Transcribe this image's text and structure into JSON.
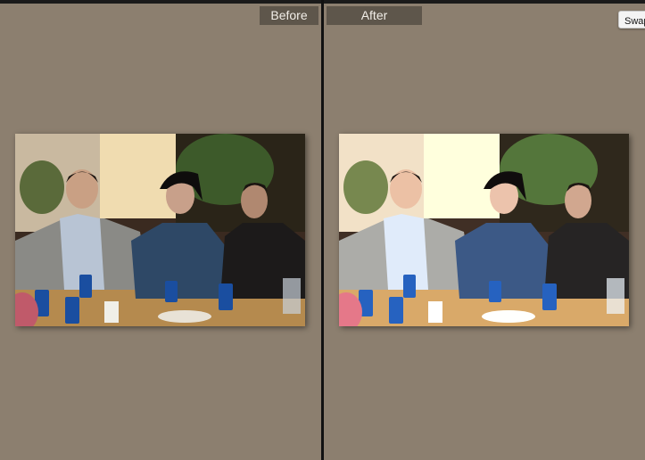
{
  "compare": {
    "before_label": "Before",
    "after_label": "After",
    "swap_label": "Swap"
  }
}
